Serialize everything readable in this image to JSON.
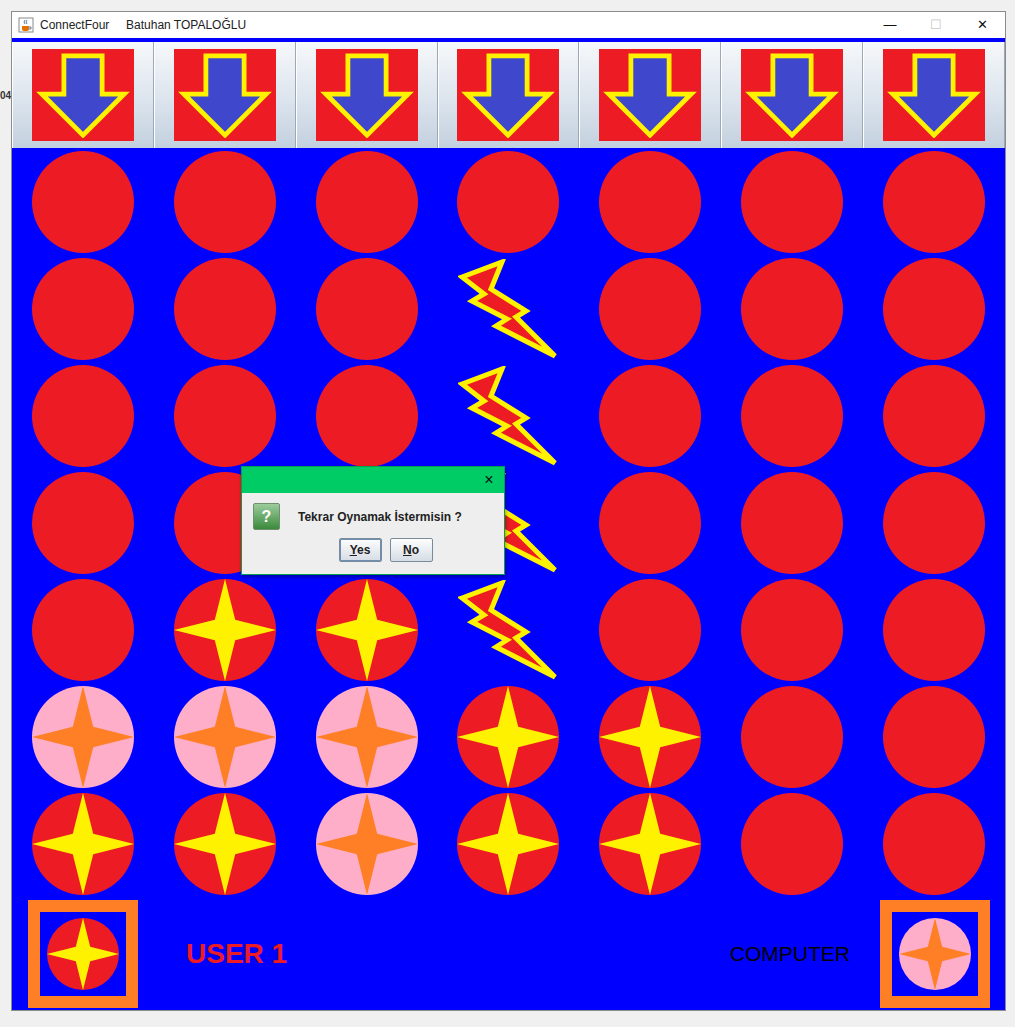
{
  "background": {
    "fragment": "04"
  },
  "window": {
    "title": "ConnectFour     Batuhan TOPALOĞLU",
    "controls": [
      {
        "label": "—",
        "disabled": false
      },
      {
        "label": "☐",
        "disabled": true
      },
      {
        "label": "✕",
        "disabled": false
      }
    ]
  },
  "board": {
    "rows": [
      [
        "empty",
        "empty",
        "empty",
        "empty",
        "empty",
        "empty",
        "empty"
      ],
      [
        "empty",
        "empty",
        "empty",
        "win",
        "empty",
        "empty",
        "empty"
      ],
      [
        "empty",
        "empty",
        "empty",
        "win",
        "empty",
        "empty",
        "empty"
      ],
      [
        "empty",
        "empty",
        "empty",
        "win",
        "empty",
        "empty",
        "empty"
      ],
      [
        "empty",
        "user",
        "user",
        "win",
        "empty",
        "empty",
        "empty"
      ],
      [
        "computer",
        "computer",
        "computer",
        "user",
        "user",
        "empty",
        "empty"
      ],
      [
        "user",
        "user",
        "computer",
        "user",
        "user",
        "empty",
        "empty"
      ]
    ]
  },
  "players": [
    {
      "name": "USER 1",
      "kind": "user",
      "selected": true
    },
    {
      "name": "COMPUTER",
      "kind": "computer",
      "selected": false
    }
  ],
  "dialog": {
    "close": "×",
    "icon": "?",
    "message": "Tekrar Oynamak İstermisin ?",
    "buttons": [
      {
        "label": "Yes",
        "focused": true,
        "underline_first": true
      },
      {
        "label": "No",
        "focused": false,
        "underline_first": true
      }
    ]
  }
}
